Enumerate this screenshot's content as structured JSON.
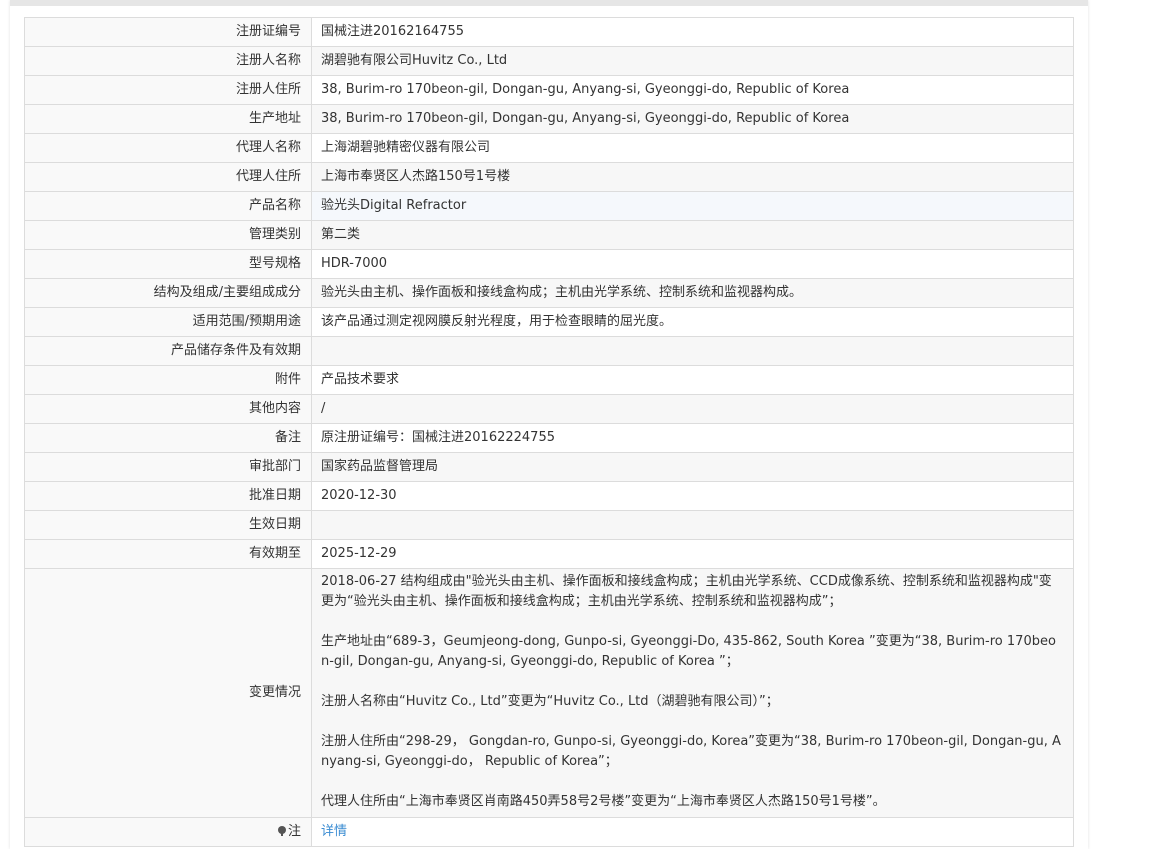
{
  "rows": [
    {
      "label": "注册证编号",
      "value": "国械注进20162164755"
    },
    {
      "label": "注册人名称",
      "value": "湖碧驰有限公司Huvitz Co., Ltd"
    },
    {
      "label": "注册人住所",
      "value": "38, Burim-ro 170beon-gil, Dongan-gu, Anyang-si, Gyeonggi-do, Republic of Korea"
    },
    {
      "label": "生产地址",
      "value": "38, Burim-ro 170beon-gil, Dongan-gu, Anyang-si, Gyeonggi-do, Republic of Korea"
    },
    {
      "label": "代理人名称",
      "value": "上海湖碧驰精密仪器有限公司"
    },
    {
      "label": "代理人住所",
      "value": "上海市奉贤区人杰路150号1号楼"
    },
    {
      "label": "产品名称",
      "value": "验光头Digital Refractor"
    },
    {
      "label": "管理类别",
      "value": "第二类"
    },
    {
      "label": "型号规格",
      "value": "HDR-7000"
    },
    {
      "label": "结构及组成/主要组成成分",
      "value": "验光头由主机、操作面板和接线盒构成；主机由光学系统、控制系统和监视器构成。"
    },
    {
      "label": "适用范围/预期用途",
      "value": "该产品通过测定视网膜反射光程度，用于检查眼睛的屈光度。"
    },
    {
      "label": "产品储存条件及有效期",
      "value": ""
    },
    {
      "label": "附件",
      "value": "产品技术要求"
    },
    {
      "label": "其他内容",
      "value": "/"
    },
    {
      "label": "备注",
      "value": "原注册证编号：国械注进20162224755"
    },
    {
      "label": "审批部门",
      "value": "国家药品监督管理局"
    },
    {
      "label": "批准日期",
      "value": "2020-12-30"
    },
    {
      "label": "生效日期",
      "value": ""
    },
    {
      "label": "有效期至",
      "value": "2025-12-29"
    }
  ],
  "changes": {
    "label": "变更情况",
    "items": [
      "2018-06-27 结构组成由\"验光头由主机、操作面板和接线盒构成；主机由光学系统、CCD成像系统、控制系统和监视器构成\"变更为“验光头由主机、操作面板和接线盒构成；主机由光学系统、控制系统和监视器构成”；",
      "生产地址由“689-3，Geumjeong-dong, Gunpo-si, Gyeonggi-Do, 435-862, South Korea ”变更为“38, Burim-ro 170beon-gil, Dongan-gu, Anyang-si, Gyeonggi-do, Republic of Korea ”；",
      "注册人名称由“Huvitz Co., Ltd”变更为“Huvitz Co., Ltd（湖碧驰有限公司）”；",
      "注册人住所由“298-29， Gongdan-ro, Gunpo-si, Gyeonggi-do, Korea”变更为“38, Burim-ro 170beon-gil, Dongan-gu, Anyang-si, Gyeonggi-do， Republic of Korea”；",
      "代理人住所由“上海市奉贤区肖南路450弄58号2号楼”变更为“上海市奉贤区人杰路150号1号楼”。"
    ]
  },
  "note": {
    "label": "注",
    "link": "详情",
    "icon": "note-icon"
  },
  "colors": {
    "link": "#3a8cd2",
    "border": "#dcdcdc",
    "label_bg": "#f9f9f9"
  }
}
